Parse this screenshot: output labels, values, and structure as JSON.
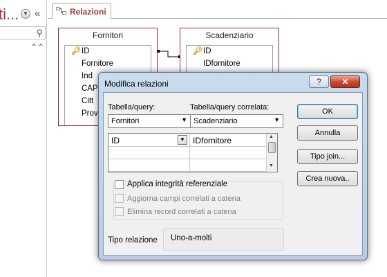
{
  "nav": {
    "title": "ti...",
    "collapse_glyph": "«",
    "dropdown_glyph": "▼",
    "search_icon": "search-icon",
    "expand_glyph": "»"
  },
  "tab": {
    "label": "Relazioni",
    "icon": "relationships-icon"
  },
  "tables": {
    "fornitori": {
      "title": "Fornitori",
      "fields": [
        "ID",
        "Fornitore",
        "Ind",
        "CAP",
        "Citt",
        "Prov"
      ],
      "key_field": "ID"
    },
    "scadenziario": {
      "title": "Scadenziario",
      "fields": [
        "ID",
        "IDfornitore"
      ],
      "key_field": "ID"
    }
  },
  "dialog": {
    "title": "Modifica relazioni",
    "help_glyph": "?",
    "close_glyph": "✕",
    "table_label": "Tabella/query:",
    "related_table_label": "Tabella/query correlata:",
    "table_value": "Fornitori",
    "related_table_value": "Scadenziario",
    "grid": [
      {
        "left": "ID",
        "right": "IDfornitore"
      },
      {
        "left": "",
        "right": ""
      },
      {
        "left": "",
        "right": ""
      }
    ],
    "enforce_integrity_label": "Applica integrità referenziale",
    "cascade_update_label": "Aggiorna campi correlati a catena",
    "cascade_delete_label": "Elimina record correlati a catena",
    "relation_type_label": "Tipo relazione",
    "relation_type_value": "Uno-a-molti",
    "buttons": {
      "ok": "OK",
      "cancel": "Annulla",
      "join_type": "Tipo join...",
      "create_new": "Crea nuova.."
    },
    "checkboxes": {
      "enforce_integrity": false,
      "cascade_update": false,
      "cascade_delete": false
    }
  },
  "colors": {
    "accent_red": "#a33a3a",
    "table_border": "#8b2a3a",
    "dialog_frame": "#c9dcee",
    "close_button": "#c7452c"
  }
}
